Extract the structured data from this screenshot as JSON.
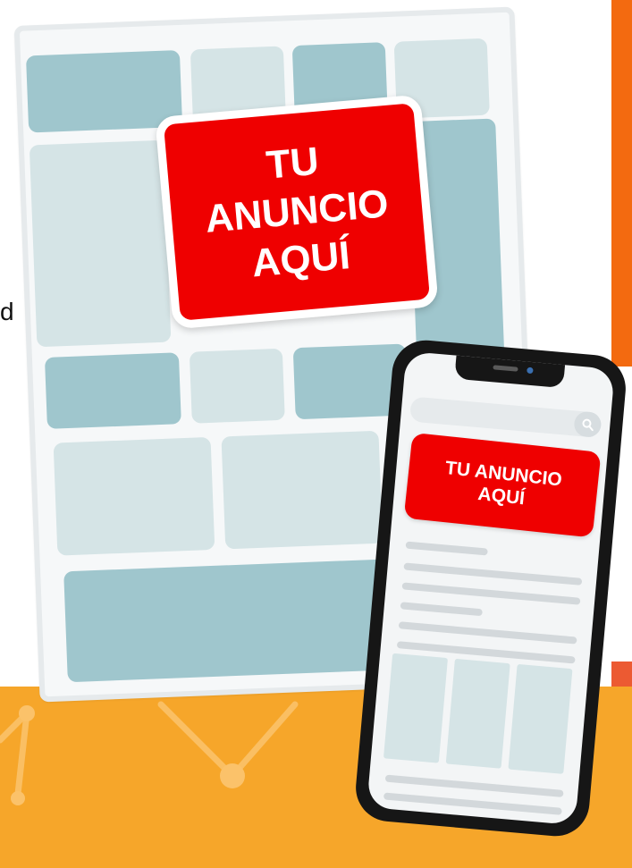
{
  "ad_banner": {
    "text": "TU\nANUNCIO\nAQUÍ"
  },
  "phone_ad": {
    "text": "TU ANUNCIO\nAQUÍ"
  },
  "cropped_text": {
    "fragment": "d"
  },
  "colors": {
    "ad_red": "#ef0000",
    "accent_orange": "#f36a10",
    "footer_yellow": "#f6a62a",
    "wireframe_dark": "#9fc6cd",
    "wireframe_light": "#d5e4e6"
  },
  "icons": {
    "search": "search-icon"
  }
}
